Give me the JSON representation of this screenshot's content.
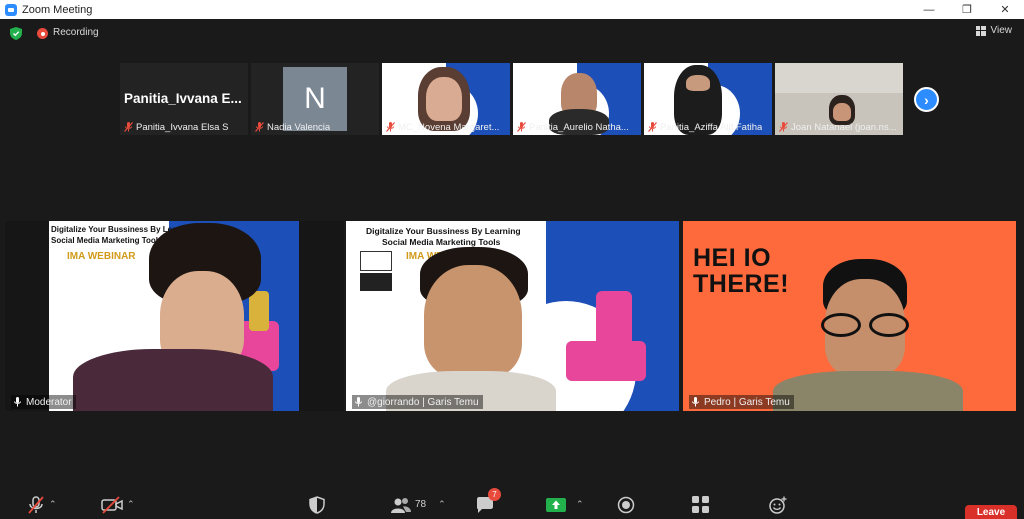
{
  "window": {
    "title": "Zoom Meeting",
    "controls": [
      "minimize",
      "maximize",
      "close"
    ]
  },
  "infobar": {
    "recording_label": "Recording",
    "view_label": "View"
  },
  "thumbnails": [
    {
      "name": "Panitia_Ivvana Elsa S",
      "display_text": "Panitia_Ivvana  E...",
      "type": "name-only"
    },
    {
      "name": "Nadia Valencia",
      "avatar_letter": "N",
      "type": "avatar"
    },
    {
      "name": "MC_Novena Margaret...",
      "type": "video"
    },
    {
      "name": "Panitia_Aurelio Natha...",
      "type": "video"
    },
    {
      "name": "Panitia_Aziffa Alif Fatiha",
      "type": "video"
    },
    {
      "name": "Joan Natanael (joan.ns...",
      "type": "video"
    }
  ],
  "tiles": [
    {
      "name": "Moderator",
      "slide_title_1": "Digitalize Your Bussiness By Learning",
      "slide_title_2": "Social Media Marketing Tools",
      "slide_sub": "IMA WEBINAR"
    },
    {
      "name": "@giorrando | Garis Temu",
      "slide_title_1": "Digitalize Your Bussiness By Learning",
      "slide_title_2": "Social Media Marketing Tools",
      "slide_sub": "IMA WEBINAR"
    },
    {
      "name": "Pedro | Garis Temu",
      "greeting_1": "HEI IO",
      "greeting_2": "THERE!"
    }
  ],
  "toolbar": {
    "participants_count": "78",
    "chat_badge": "7",
    "leave_label": "Leave"
  },
  "colors": {
    "accent": "#2d8cff",
    "active_speaker": "#d6e86a",
    "leave": "#d9302a",
    "tile_orange": "#ff6a3d",
    "slide_blue": "#1d4fb8"
  }
}
